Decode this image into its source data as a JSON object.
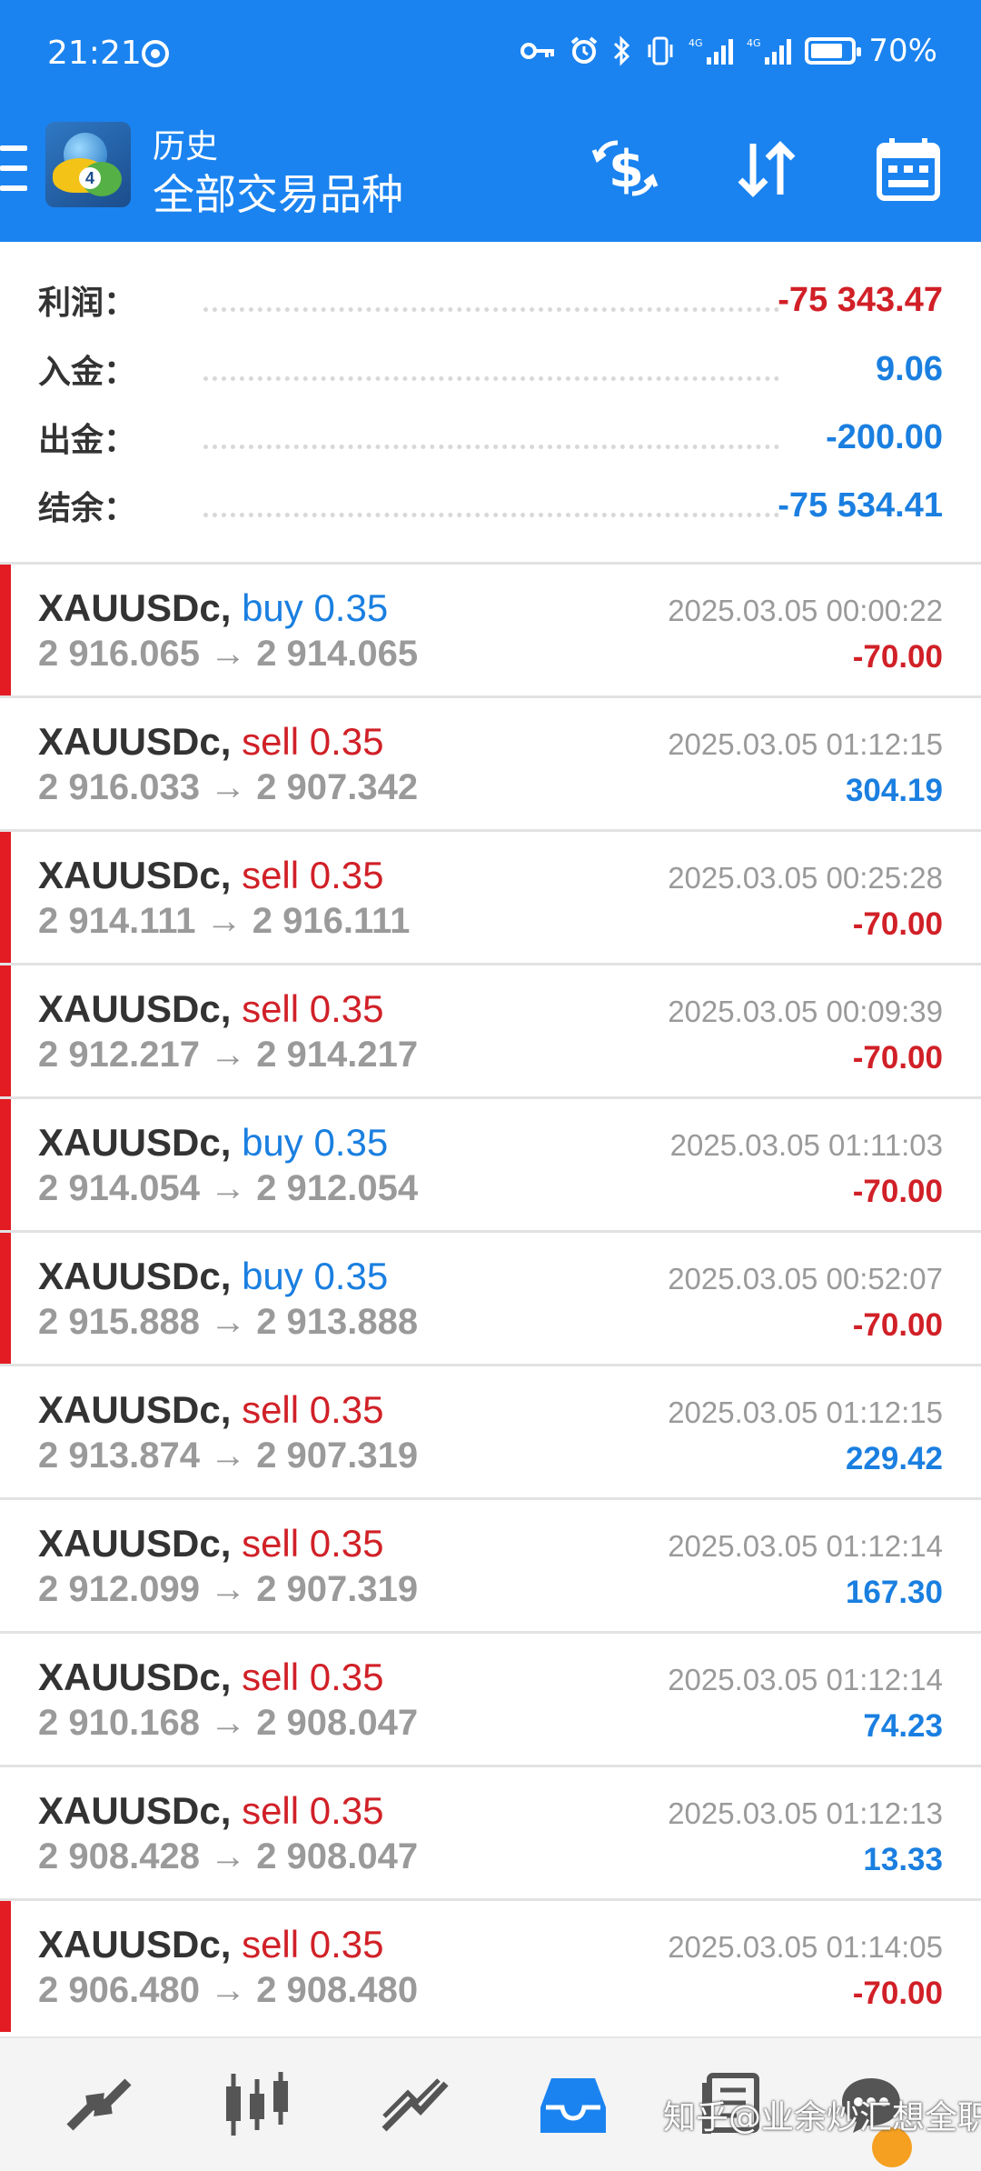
{
  "status_bar": {
    "time": "21:21",
    "battery_percent": "70%",
    "icons": [
      "hotspot-icon",
      "key-icon",
      "alarm-icon",
      "bluetooth-icon",
      "vibrate-icon",
      "signal-4g-icon",
      "signal-4g-icon",
      "battery-icon"
    ]
  },
  "header": {
    "subtitle": "历史",
    "title": "全部交易品种",
    "buttons": [
      "deposit-withdraw-icon",
      "sort-icon",
      "calendar-icon"
    ]
  },
  "summary": {
    "profit": {
      "label": "利润：",
      "value": "-75 343.47",
      "color": "#d12027"
    },
    "deposit": {
      "label": "入金：",
      "value": "9.06",
      "color": "#1a7fe0"
    },
    "withdrawal": {
      "label": "出金：",
      "value": "-200.00",
      "color": "#1a7fe0"
    },
    "balance": {
      "label": "结余：",
      "value": "-75 534.41",
      "color": "#1a7fe0"
    }
  },
  "trades": [
    {
      "symbol": "XAUUSDc,",
      "side": "buy 0.35",
      "type": "buy",
      "open": "2 916.065",
      "close": "2 914.065",
      "time": "2025.03.05 00:00:22",
      "profit": "-70.00",
      "loss": true
    },
    {
      "symbol": "XAUUSDc,",
      "side": "sell 0.35",
      "type": "sell",
      "open": "2 916.033",
      "close": "2 907.342",
      "time": "2025.03.05 01:12:15",
      "profit": "304.19",
      "loss": false
    },
    {
      "symbol": "XAUUSDc,",
      "side": "sell 0.35",
      "type": "sell",
      "open": "2 914.111",
      "close": "2 916.111",
      "time": "2025.03.05 00:25:28",
      "profit": "-70.00",
      "loss": true
    },
    {
      "symbol": "XAUUSDc,",
      "side": "sell 0.35",
      "type": "sell",
      "open": "2 912.217",
      "close": "2 914.217",
      "time": "2025.03.05 00:09:39",
      "profit": "-70.00",
      "loss": true
    },
    {
      "symbol": "XAUUSDc,",
      "side": "buy 0.35",
      "type": "buy",
      "open": "2 914.054",
      "close": "2 912.054",
      "time": "2025.03.05 01:11:03",
      "profit": "-70.00",
      "loss": true
    },
    {
      "symbol": "XAUUSDc,",
      "side": "buy 0.35",
      "type": "buy",
      "open": "2 915.888",
      "close": "2 913.888",
      "time": "2025.03.05 00:52:07",
      "profit": "-70.00",
      "loss": true
    },
    {
      "symbol": "XAUUSDc,",
      "side": "sell 0.35",
      "type": "sell",
      "open": "2 913.874",
      "close": "2 907.319",
      "time": "2025.03.05 01:12:15",
      "profit": "229.42",
      "loss": false
    },
    {
      "symbol": "XAUUSDc,",
      "side": "sell 0.35",
      "type": "sell",
      "open": "2 912.099",
      "close": "2 907.319",
      "time": "2025.03.05 01:12:14",
      "profit": "167.30",
      "loss": false
    },
    {
      "symbol": "XAUUSDc,",
      "side": "sell 0.35",
      "type": "sell",
      "open": "2 910.168",
      "close": "2 908.047",
      "time": "2025.03.05 01:12:14",
      "profit": "74.23",
      "loss": false
    },
    {
      "symbol": "XAUUSDc,",
      "side": "sell 0.35",
      "type": "sell",
      "open": "2 908.428",
      "close": "2 908.047",
      "time": "2025.03.05 01:12:13",
      "profit": "13.33",
      "loss": false
    },
    {
      "symbol": "XAUUSDc,",
      "side": "sell 0.35",
      "type": "sell",
      "open": "2 906.480",
      "close": "2 908.480",
      "time": "2025.03.05 01:14:05",
      "profit": "-70.00",
      "loss": true
    }
  ],
  "bottom_nav": {
    "items": [
      "quotes-icon",
      "chart-icon",
      "trade-icon",
      "history-icon",
      "messages-icon",
      "chat-icon"
    ],
    "active": "history-icon"
  },
  "watermark": "知乎@业余炒汇想全职",
  "colors": {
    "header_blue": "#1a83f0",
    "buy_blue": "#1a7fe0",
    "sell_red": "#d12027",
    "loss_bar": "#e31b23",
    "muted_gray": "#9a9a9a"
  }
}
